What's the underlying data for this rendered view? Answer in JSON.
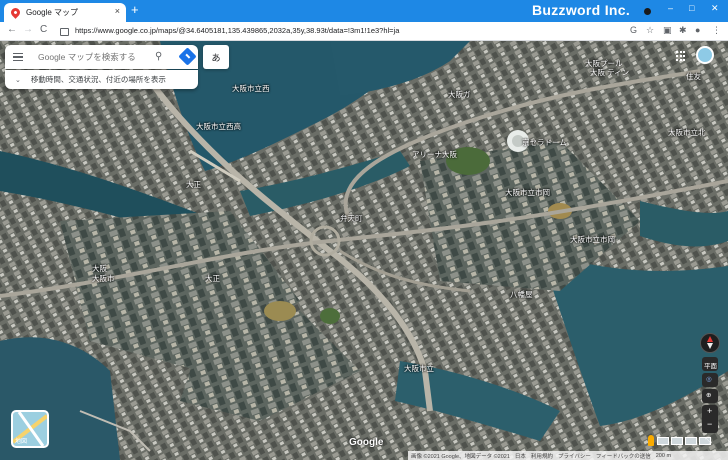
{
  "browser": {
    "tab_title": "Google マップ",
    "new_tab": "+",
    "close_tab": "×",
    "brand": "Buzzword Inc.",
    "url": "https://www.google.co.jp/maps/@34.6405181,135.439865,2032a,35y,38.93t/data=!3m1!1e3?hl=ja",
    "win_min": "–",
    "win_max": "□",
    "win_close": "✕",
    "nav_back": "←",
    "nav_forward": "→",
    "nav_reload": "C"
  },
  "search": {
    "placeholder": "Google マップを検索する",
    "suggestion": "移動時間、交通状況、付近の場所を表示",
    "ime": "あ"
  },
  "map_labels": [
    {
      "text": "大阪プール"
    },
    {
      "text": "大阪 ティン"
    },
    {
      "text": "大阪ガ"
    },
    {
      "text": "大阪市立西"
    },
    {
      "text": "住友"
    },
    {
      "text": "大阪市立北"
    },
    {
      "text": "大阪市立西高"
    },
    {
      "text": "京セラドーム"
    },
    {
      "text": "アリーナ大阪"
    },
    {
      "text": "大阪市立市岡"
    },
    {
      "text": "大阪市立市岡"
    },
    {
      "text": "大阪"
    },
    {
      "text": "大正"
    },
    {
      "text": "弁天町"
    },
    {
      "text": "大正"
    },
    {
      "text": "八幡屋"
    },
    {
      "text": "大阪市立"
    },
    {
      "text": "大阪市"
    }
  ],
  "controls": {
    "layers_label": "地図",
    "google_logo": "Google",
    "tilt_label": "平面",
    "zoom_in": "+",
    "zoom_out": "−",
    "expand": "⤡"
  },
  "footer": {
    "items": [
      "画像 ©2021 Google、地図データ ©2021",
      "日本",
      "利用規約",
      "プライバシー",
      "フィードバックの送信",
      "200 m"
    ]
  },
  "colors": {
    "browser_accent": "#1e88e5",
    "search_button": "#1a73e8",
    "water": "#1f4f5c"
  }
}
